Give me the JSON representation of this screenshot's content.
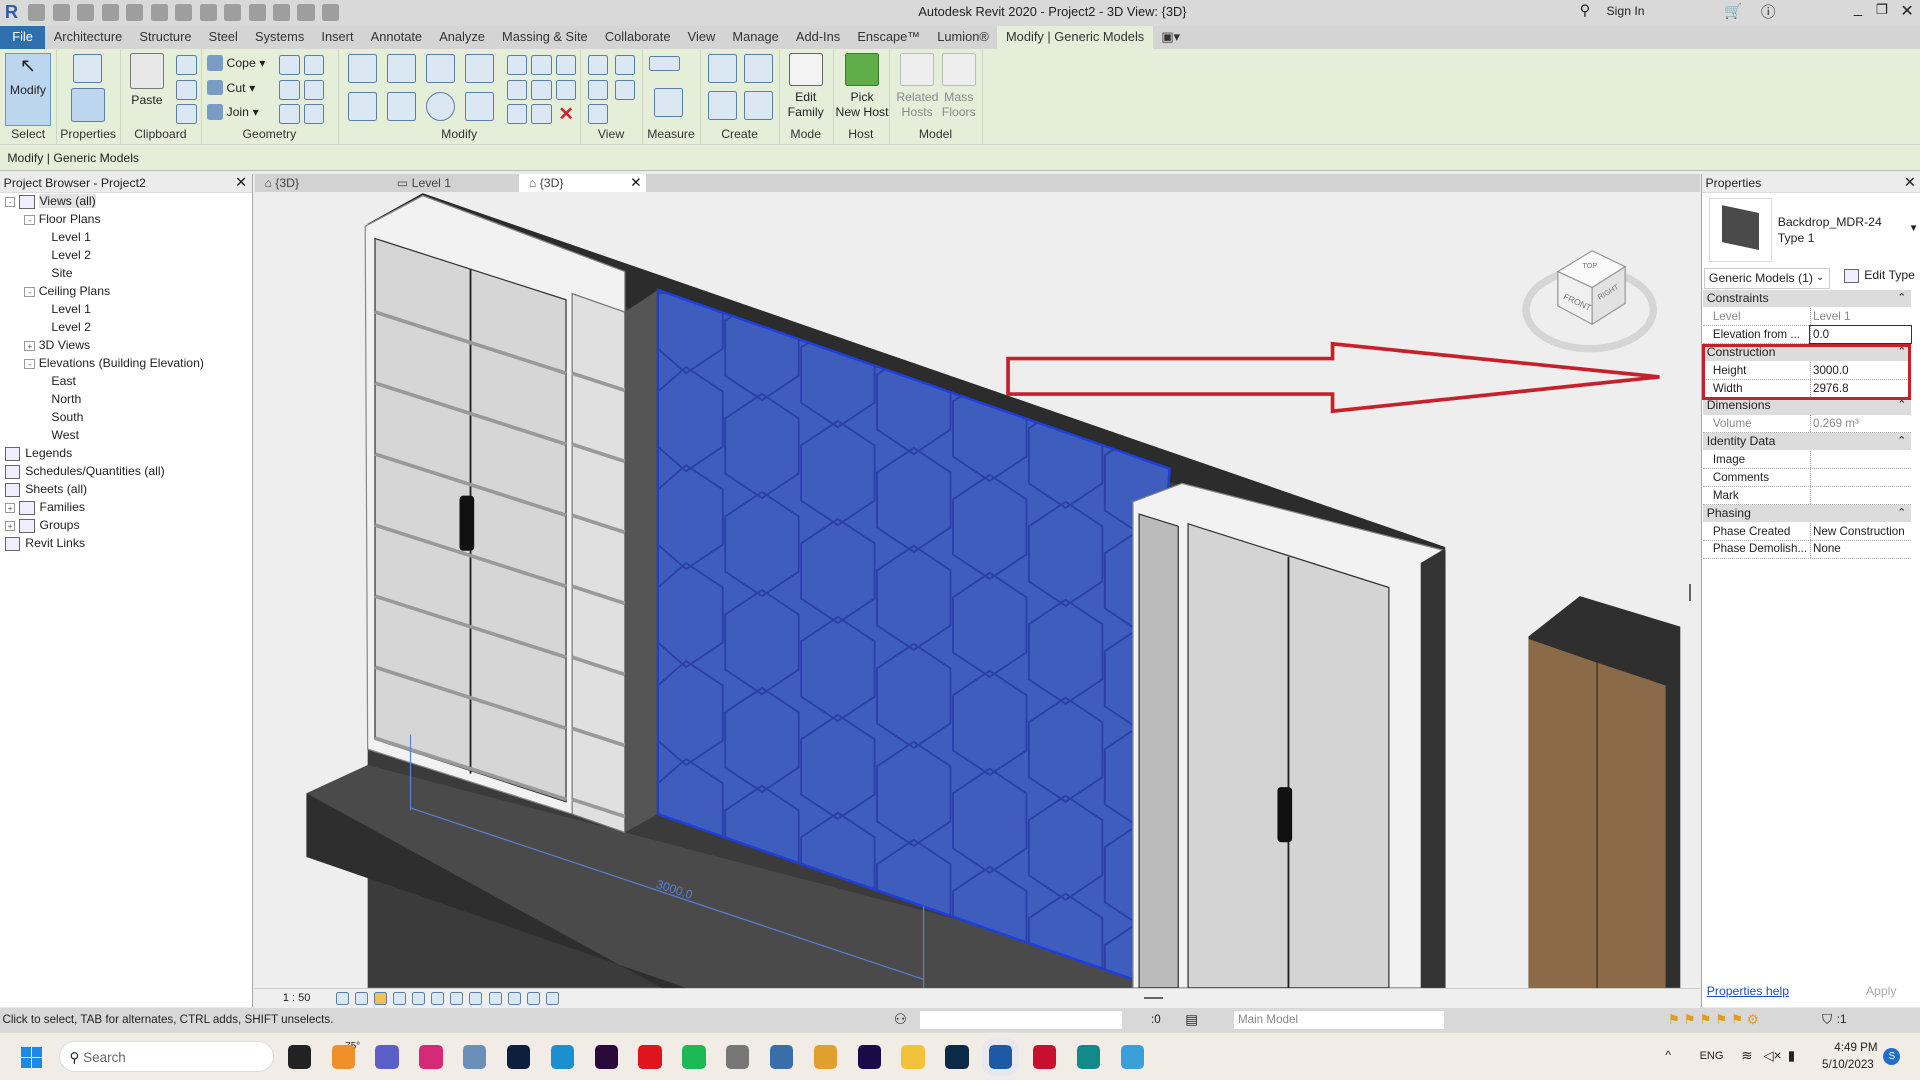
{
  "window": {
    "title": "Autodesk Revit 2020 - Project2 - 3D View: {3D}",
    "sign_in": "Sign In"
  },
  "menu_tabs": [
    "File",
    "Architecture",
    "Structure",
    "Steel",
    "Systems",
    "Insert",
    "Annotate",
    "Analyze",
    "Massing & Site",
    "Collaborate",
    "View",
    "Manage",
    "Add-Ins",
    "Enscape™",
    "Lumion®",
    "Modify | Generic Models"
  ],
  "active_tab": "Modify | Generic Models",
  "ribbon": {
    "panels": [
      "Select",
      "Properties",
      "Clipboard",
      "Geometry",
      "Modify",
      "View",
      "Measure",
      "Create",
      "Mode",
      "Host",
      "Model"
    ],
    "modify_btn": "Modify",
    "paste_btn": "Paste",
    "geometry": {
      "cope": "Cope",
      "cut": "Cut",
      "join": "Join"
    },
    "edit_family": [
      "Edit",
      "Family"
    ],
    "pick_new_host": [
      "Pick",
      "New Host"
    ],
    "related_hosts": [
      "Related",
      "Hosts"
    ],
    "mass_floors": [
      "Mass",
      "Floors"
    ]
  },
  "options_bar": "Modify | Generic Models",
  "project_browser": {
    "title": "Project Browser - Project2",
    "items": [
      {
        "label": "Views (all)",
        "level": 0,
        "exp": "-"
      },
      {
        "label": "Floor Plans",
        "level": 1,
        "exp": "-"
      },
      {
        "label": "Level 1",
        "level": 2
      },
      {
        "label": "Level 2",
        "level": 2
      },
      {
        "label": "Site",
        "level": 2
      },
      {
        "label": "Ceiling Plans",
        "level": 1,
        "exp": "-"
      },
      {
        "label": "Level 1",
        "level": 2
      },
      {
        "label": "Level 2",
        "level": 2
      },
      {
        "label": "3D Views",
        "level": 1,
        "exp": "+"
      },
      {
        "label": "Elevations (Building Elevation)",
        "level": 1,
        "exp": "-"
      },
      {
        "label": "East",
        "level": 2
      },
      {
        "label": "North",
        "level": 2
      },
      {
        "label": "South",
        "level": 2
      },
      {
        "label": "West",
        "level": 2
      },
      {
        "label": "Legends",
        "level": 0
      },
      {
        "label": "Schedules/Quantities (all)",
        "level": 0
      },
      {
        "label": "Sheets (all)",
        "level": 0
      },
      {
        "label": "Families",
        "level": 0,
        "exp": "+"
      },
      {
        "label": "Groups",
        "level": 0,
        "exp": "+"
      },
      {
        "label": "Revit Links",
        "level": 0
      }
    ]
  },
  "view_tabs": [
    {
      "label": "{3D}"
    },
    {
      "label": "Level 1"
    },
    {
      "label": "{3D}",
      "active": true
    }
  ],
  "viewport": {
    "dimension_label": "3000.0",
    "viewcube": {
      "top": "TOP",
      "front": "FRONT",
      "right": "RIGHT"
    },
    "scale": "1 : 50",
    "selection_color": "#2f4fd0",
    "annotation_color": "#c8202a"
  },
  "properties": {
    "title": "Properties",
    "family": "Backdrop_MDR-24",
    "type": "Type 1",
    "selector": "Generic Models (1)",
    "edit_type": "Edit Type",
    "sections": [
      {
        "name": "Constraints",
        "rows": [
          {
            "k": "Level",
            "v": "Level 1",
            "grey": true
          },
          {
            "k": "Elevation from ...",
            "v": "0.0"
          }
        ]
      },
      {
        "name": "Construction",
        "rows": [
          {
            "k": "Height",
            "v": "3000.0"
          },
          {
            "k": "Width",
            "v": "2976.8"
          }
        ]
      },
      {
        "name": "Dimensions",
        "rows": [
          {
            "k": "Volume",
            "v": "0.269 m³",
            "grey": true
          }
        ]
      },
      {
        "name": "Identity Data",
        "rows": [
          {
            "k": "Image",
            "v": ""
          },
          {
            "k": "Comments",
            "v": ""
          },
          {
            "k": "Mark",
            "v": ""
          }
        ]
      },
      {
        "name": "Phasing",
        "rows": [
          {
            "k": "Phase Created",
            "v": "New Construction"
          },
          {
            "k": "Phase Demolish...",
            "v": "None"
          }
        ]
      }
    ],
    "help": "Properties help",
    "apply": "Apply"
  },
  "status": {
    "hint": "Click to select, TAB for alternates, CTRL adds, SHIFT unselects.",
    "workset_count": ":0",
    "model": "Main Model",
    "filter_count": ":1"
  },
  "taskbar": {
    "search": "Search",
    "weather": "75°",
    "lang": "ENG",
    "time": "4:49 PM",
    "date": "5/10/2023",
    "apps": [
      {
        "name": "file-explorer",
        "color": "#222"
      },
      {
        "name": "weather",
        "color": "#f0902a"
      },
      {
        "name": "teams",
        "color": "#5b5fc7"
      },
      {
        "name": "instagram",
        "color": "#d62976"
      },
      {
        "name": "chart-app",
        "color": "#6a8fb8"
      },
      {
        "name": "lightroom-classic",
        "color": "#0e1f3d"
      },
      {
        "name": "edge",
        "color": "#1c8fcf"
      },
      {
        "name": "premiere",
        "color": "#2a0a3a"
      },
      {
        "name": "opera",
        "color": "#e0141e"
      },
      {
        "name": "spotify",
        "color": "#1db954"
      },
      {
        "name": "app-11",
        "color": "#777"
      },
      {
        "name": "app-12",
        "color": "#3a6ea8"
      },
      {
        "name": "media-player",
        "color": "#e0a030"
      },
      {
        "name": "after-effects",
        "color": "#1a0b48"
      },
      {
        "name": "folder",
        "color": "#f2c23a"
      },
      {
        "name": "photoshop",
        "color": "#0c2a46"
      },
      {
        "name": "revit",
        "color": "#1c5aa8"
      },
      {
        "name": "autocad",
        "color": "#c8102e"
      },
      {
        "name": "3ds-max",
        "color": "#138a8a"
      },
      {
        "name": "globe-app",
        "color": "#3aa0d8"
      }
    ]
  }
}
